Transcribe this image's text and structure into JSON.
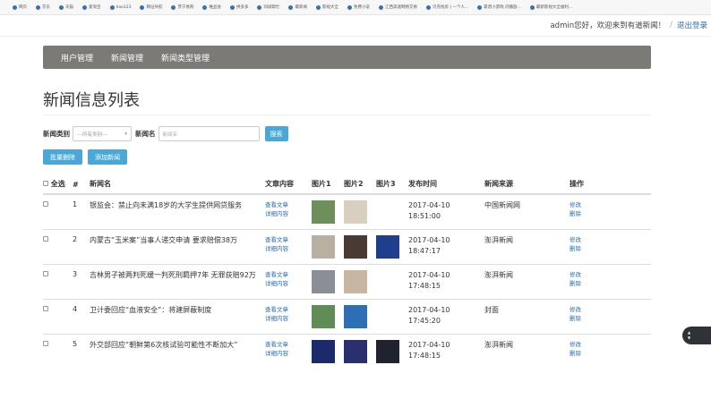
{
  "bookmarks": [
    "网页",
    "京东",
    "天猫",
    "爱淘宝",
    "hao123",
    "网址导航",
    "苏宁易购",
    "唯品会",
    "拼多多",
    "同城帮忙",
    "最新闻",
    "影视大全",
    "免费小说",
    "江西高速网络交易",
    "贝壳找房 | 一个人...",
    "靠谱小游戏 闪播放...",
    "最新影视大全福利..."
  ],
  "userbar": {
    "greeting": "admin您好，欢迎来到有道新闻！",
    "sep": "/",
    "logout": "退出登录"
  },
  "nav": {
    "items": [
      "用户管理",
      "新闻管理",
      "新闻类型管理"
    ]
  },
  "page": {
    "title": "新闻信息列表"
  },
  "search": {
    "category_label": "新闻类别",
    "category_value": "---所有类别---",
    "name_label": "新闻名",
    "name_placeholder": "新闻名",
    "search_button": "搜索"
  },
  "actions": {
    "batch_delete": "批量删除",
    "add_news": "添加新闻"
  },
  "table": {
    "headers": {
      "select_all": "全选",
      "index": "#",
      "title": "新闻名",
      "content": "文章内容",
      "pic1": "图片1",
      "pic2": "图片2",
      "pic3": "图片3",
      "date": "发布时间",
      "source": "新闻来源",
      "ops": "操作"
    },
    "view_article": "查看文章",
    "view_detail": "详细内容",
    "edit": "修改",
    "delete": "删除",
    "rows": [
      {
        "index": "1",
        "title": "银监会：禁止向未满18岁的大学生提供网贷服务",
        "date": "2017-04-10",
        "time": "18:51:00",
        "source": "中国新闻网",
        "pics": [
          1,
          1,
          0
        ]
      },
      {
        "index": "2",
        "title": "内蒙古“玉米案”当事人递交申请 要求赔偿38万",
        "date": "2017-04-10",
        "time": "18:47:17",
        "source": "澎湃新闻",
        "pics": [
          1,
          1,
          1
        ]
      },
      {
        "index": "3",
        "title": "吉林男子被两判死缓一判死刑羁押7年 无罪获赔92万",
        "date": "2017-04-10",
        "time": "17:48:15",
        "source": "澎湃新闻",
        "pics": [
          1,
          1,
          0
        ]
      },
      {
        "index": "4",
        "title": "卫计委回应“血液安全”：将建屏蔽制度",
        "date": "2017-04-10",
        "time": "17:45:20",
        "source": "封面",
        "pics": [
          1,
          1,
          0
        ]
      },
      {
        "index": "5",
        "title": "外交部回应“朝鲜第6次核试验可能性不断加大”",
        "date": "2017-04-10",
        "time": "17:48:15",
        "source": "澎湃新闻",
        "pics": [
          1,
          1,
          1
        ]
      }
    ]
  },
  "colors": {
    "nav_bg": "#7c7a76",
    "button": "#4aa8d8",
    "link": "#2a6eb8"
  }
}
